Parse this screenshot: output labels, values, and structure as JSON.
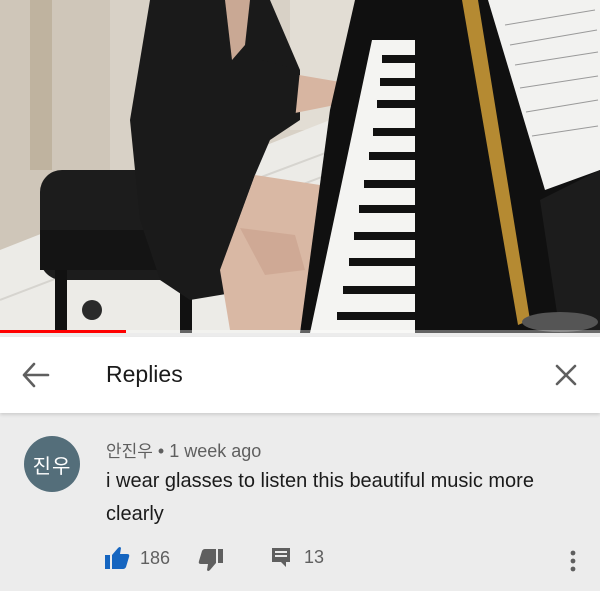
{
  "video": {
    "progress": 0.21
  },
  "replies_header": {
    "title": "Replies"
  },
  "comment": {
    "avatar_text": "진우",
    "author": "안진우",
    "separator": " • ",
    "time": "1 week ago",
    "text": "i wear glasses to listen this beautiful music more clearly",
    "likes": "186",
    "replies": "13"
  },
  "icons": {
    "back": "arrow-left-icon",
    "close": "close-icon",
    "like": "thumbs-up-icon",
    "dislike": "thumbs-down-icon",
    "reply": "comment-icon",
    "more": "more-vert-icon"
  },
  "colors": {
    "like_active": "#1565c0",
    "progress": "#ff0000",
    "avatar_bg": "#546e7a",
    "icon_gray": "#5f5f5f"
  }
}
